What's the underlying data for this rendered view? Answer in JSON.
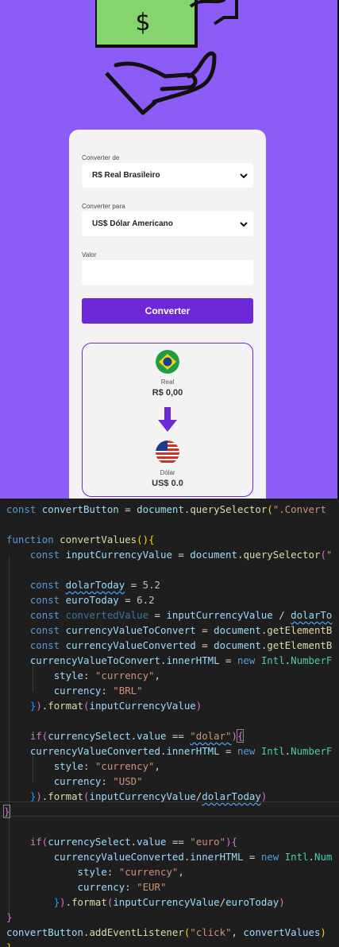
{
  "form": {
    "from_label": "Converter de",
    "from_value": "R$ Real Brasileiro",
    "to_label": "Converter para",
    "to_value": "US$ Dólar Americano",
    "amount_label": "Valor",
    "amount_value": "",
    "convert_button": "Converter"
  },
  "result": {
    "source_name": "Real",
    "source_value": "R$ 0,00",
    "target_name": "Dólar",
    "target_value": "US$ 0.0"
  },
  "colors": {
    "page_background": "#8b5cf6",
    "accent": "#6d28d9",
    "money_green": "#86d46d",
    "editor_background": "#1e1e1e"
  },
  "icons": [
    "dollar-bill-icon",
    "hand-icon",
    "chevron-down-icon",
    "brazil-flag-icon",
    "arrow-down-icon",
    "usa-flag-icon"
  ],
  "code": {
    "l1_a": "const",
    "l1_b": "convertButton",
    "l1_c": " = ",
    "l1_d": "document",
    "l1_e": ".",
    "l1_f": "querySelector",
    "l1_g": "(",
    "l1_h": "\".Convert",
    "l3_a": "function",
    "l3_b": "convertValues",
    "l3_c": "()",
    "l3_d": "{",
    "l4_a": "const",
    "l4_b": "inputCurrencyValue",
    "l4_c": " = ",
    "l4_d": "document",
    "l4_e": ".",
    "l4_f": "querySelector",
    "l4_g": "(",
    "l4_h": "\"",
    "l6_a": "const",
    "l6_b": "dolarToday",
    "l6_c": " = ",
    "l6_d": "5.2",
    "l7_a": "const",
    "l7_b": "euroToday",
    "l7_c": " = ",
    "l7_d": "6.2",
    "l8_a": "const",
    "l8_b": "convertedValue",
    "l8_c": " = ",
    "l8_d": "inputCurrencyValue",
    "l8_e": " / ",
    "l8_f": "dolarTo",
    "l9_a": "const",
    "l9_b": "currencyValueToConvert",
    "l9_c": " = ",
    "l9_d": "document",
    "l9_e": ".",
    "l9_f": "getElementB",
    "l10_a": "const",
    "l10_b": "currencyValueConverted",
    "l10_c": " = ",
    "l10_d": "document",
    "l10_e": ".",
    "l10_f": "getElementB",
    "l11_a": "currencyValueToConvert",
    "l11_b": ".",
    "l11_c": "innerHTML",
    "l11_d": " = ",
    "l11_e": "new",
    "l11_f": "Intl",
    "l11_g": ".",
    "l11_h": "NumberF",
    "l12_a": "style",
    "l12_b": ": ",
    "l12_c": "\"currency\"",
    "l12_d": ",",
    "l13_a": "currency",
    "l13_b": ": ",
    "l13_c": "\"BRL\"",
    "l14_a": "}",
    "l14_b": ")",
    "l14_c": ".",
    "l14_d": "format",
    "l14_e": "(",
    "l14_f": "inputCurrencyValue",
    "l14_g": ")",
    "l16_a": "if",
    "l16_b": "(",
    "l16_c": "currencySelect",
    "l16_d": ".",
    "l16_e": "value",
    "l16_f": " == ",
    "l16_g": "\"dolar\"",
    "l16_h": ")",
    "l16_i": "{",
    "l17_a": "currencyValueConverted",
    "l17_b": ".",
    "l17_c": "innerHTML",
    "l17_d": " = ",
    "l17_e": "new",
    "l17_f": "Intl",
    "l17_g": ".",
    "l17_h": "NumberF",
    "l18_a": "style",
    "l18_b": ": ",
    "l18_c": "\"currency\"",
    "l18_d": ",",
    "l19_a": "currency",
    "l19_b": ": ",
    "l19_c": "\"USD\"",
    "l20_a": "}",
    "l20_b": ")",
    "l20_c": ".",
    "l20_d": "format",
    "l20_e": "(",
    "l20_f": "inputCurrencyValue",
    "l20_g": "/",
    "l20_h": "dolarToday",
    "l20_i": ")",
    "l21_a": "}",
    "l23_a": "if",
    "l23_b": "(",
    "l23_c": "currencySelect",
    "l23_d": ".",
    "l23_e": "value",
    "l23_f": " == ",
    "l23_g": "\"euro\"",
    "l23_h": ")",
    "l23_i": "{",
    "l24_a": "currencyValueConverted",
    "l24_b": ".",
    "l24_c": "innerHTML",
    "l24_d": " = ",
    "l24_e": "new",
    "l24_f": "Intl",
    "l24_g": ".",
    "l24_h": "Num",
    "l25_a": "style",
    "l25_b": ": ",
    "l25_c": "\"currency\"",
    "l25_d": ",",
    "l26_a": "currency",
    "l26_b": ": ",
    "l26_c": "\"EUR\"",
    "l27_a": "}",
    "l27_b": ")",
    "l27_c": ".",
    "l27_d": "format",
    "l27_e": "(",
    "l27_f": "inputCurrencyValue",
    "l27_g": "/",
    "l27_h": "euroToday",
    "l27_i": ")",
    "l28_a": "}",
    "l29_a": "convertButton",
    "l29_b": ".",
    "l29_c": "addEventListener",
    "l29_d": "(",
    "l29_e": "\"click\"",
    "l29_f": ", ",
    "l29_g": "convertValues",
    "l29_h": ")",
    "l30_a": "}"
  }
}
